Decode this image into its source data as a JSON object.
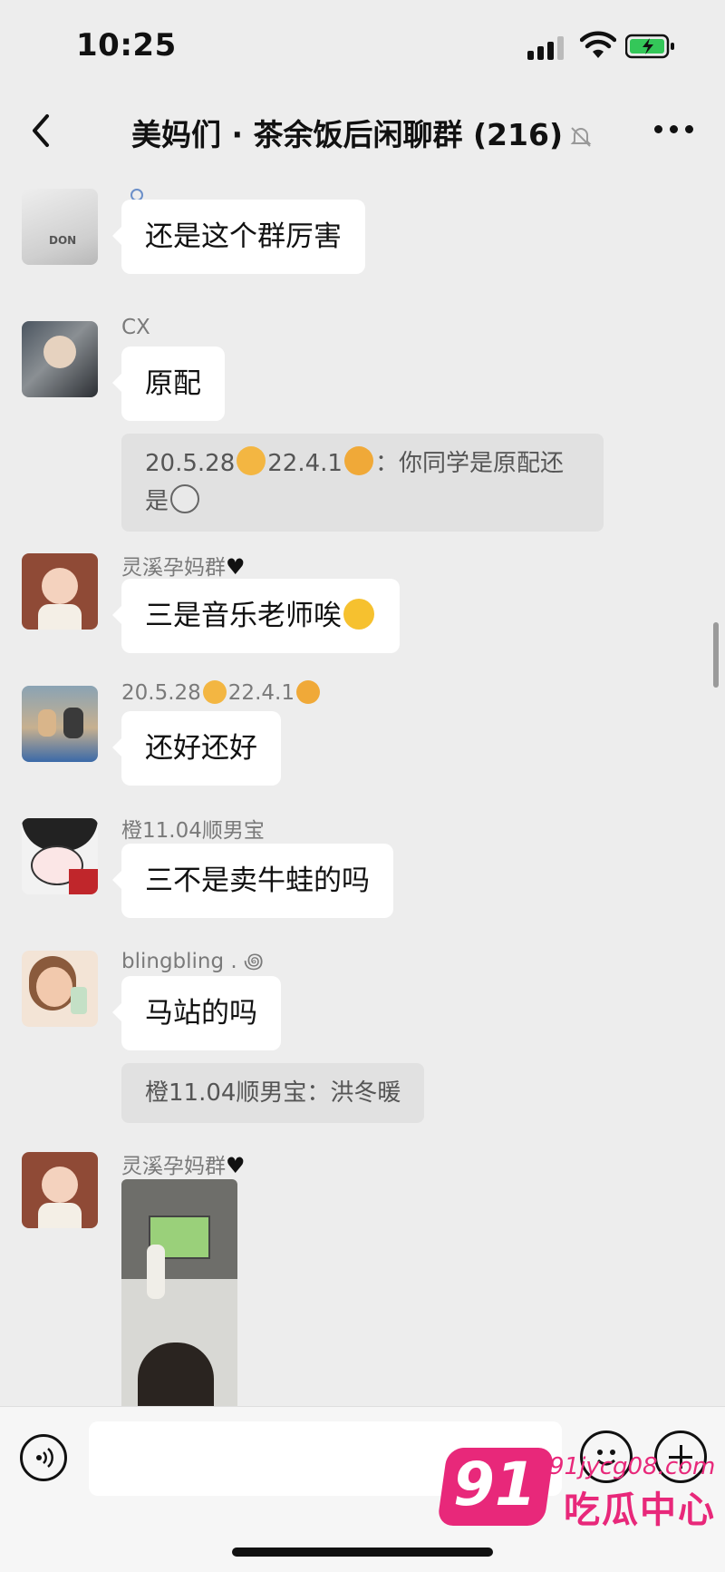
{
  "status_bar": {
    "time": "10:25"
  },
  "header": {
    "title": "美妈们 · 茶余饭后闲聊群 (216)"
  },
  "messages": [
    {
      "sender": "",
      "text": "还是这个群厉害"
    },
    {
      "sender": "CX",
      "text": "原配",
      "quote": {
        "prefix": "20.5.28",
        "mid": "22.4.1",
        "suffix": "：你同学是原配还",
        "line2": "是"
      }
    },
    {
      "sender": "灵溪孕妈群",
      "text": "三是音乐老师唉"
    },
    {
      "sender_a": "20.5.28",
      "sender_b": "22.4.1",
      "text": "还好还好"
    },
    {
      "sender": "橙11.04顺男宝",
      "text": "三不是卖牛蛙的吗"
    },
    {
      "sender": "blingbling . ꩜",
      "text": "马站的吗",
      "quote": {
        "text": "橙11.04顺男宝：洪冬暖"
      }
    },
    {
      "sender": "灵溪孕妈群",
      "image": "classroom-photo"
    }
  ],
  "watermark": {
    "number": "91",
    "url": "91jycg08.com",
    "name": "吃瓜中心"
  },
  "colors": {
    "background": "#ededed",
    "bubble": "#ffffff",
    "quote": "#e1e1e1",
    "watermark": "#e8287a"
  }
}
